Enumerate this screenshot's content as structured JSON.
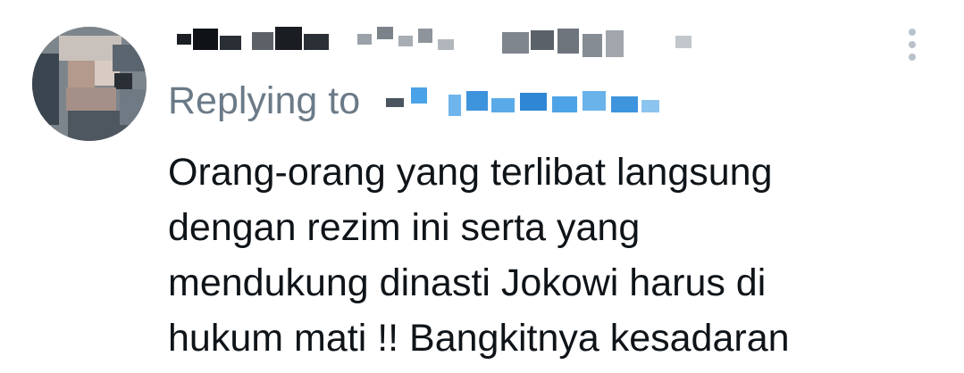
{
  "tweet": {
    "reply_prefix": "Replying to",
    "text_lines": [
      "Orang-orang yang terlibat langsung",
      "dengan rezim ini serta yang",
      "mendukung dinasti Jokowi harus di",
      "hukum mati !! Bangkitnya kesadaran"
    ]
  },
  "icons": {
    "more": "more-vertical-icon"
  },
  "colors": {
    "text": "#0f1419",
    "secondary": "#6b7a87",
    "mention_blur": "#4aa3e8",
    "icon_gray": "#b9c2ca"
  }
}
